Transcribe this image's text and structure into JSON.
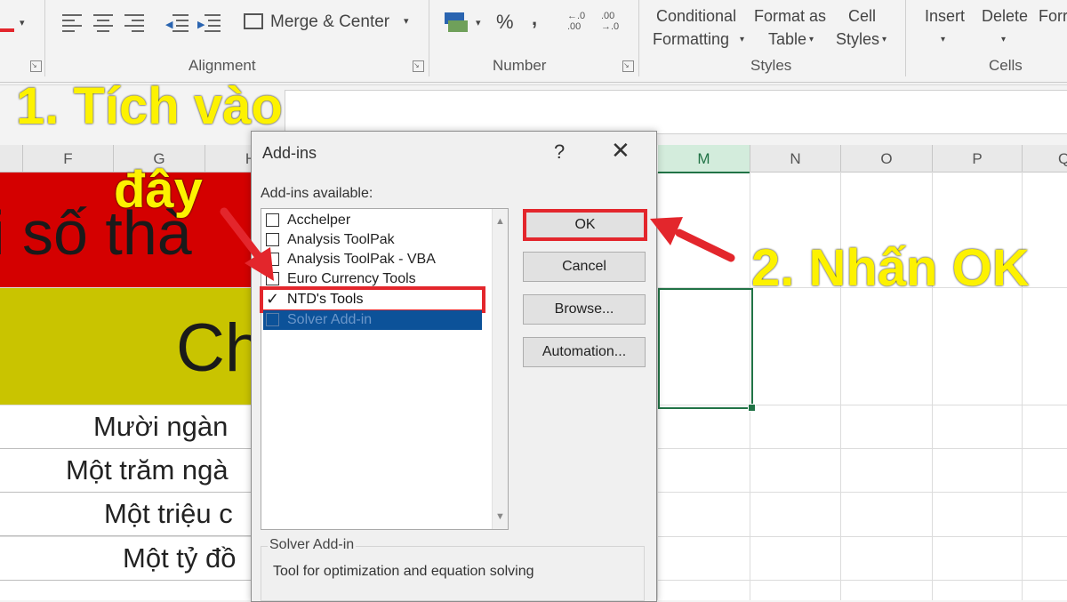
{
  "ribbon": {
    "merge_label": "Merge & Center",
    "alignment_label": "Alignment",
    "percent_symbol": "%",
    "comma_symbol": ",",
    "number_label": "Number",
    "conditional_line1": "Conditional",
    "conditional_line2": "Formatting",
    "format_table_line1": "Format as",
    "format_table_line2": "Table",
    "cell_styles_line1": "Cell",
    "cell_styles_line2": "Styles",
    "styles_label": "Styles",
    "insert_label": "Insert",
    "delete_label": "Delete",
    "format_label": "Forr",
    "cells_label": "Cells"
  },
  "columns": [
    "F",
    "G",
    "H",
    "M",
    "N",
    "O",
    "P",
    "Q"
  ],
  "sheet": {
    "red_row_text": "i số thà",
    "yellow_row_text": "Ch",
    "rows": [
      "Mười ngàn",
      "Một trăm ngà",
      "Một triệu c",
      "Một tỷ đồ"
    ]
  },
  "dialog": {
    "title": "Add-ins",
    "help": "?",
    "close": "✕",
    "available_label": "Add-ins available:",
    "items": [
      {
        "label": "Acchelper",
        "checked": false
      },
      {
        "label": "Analysis ToolPak",
        "checked": false
      },
      {
        "label": "Analysis ToolPak - VBA",
        "checked": false
      },
      {
        "label": "Euro Currency Tools",
        "checked": false
      },
      {
        "label": "NTD's Tools",
        "checked": true
      },
      {
        "label": "Solver Add-in",
        "checked": false
      }
    ],
    "check_glyph": "✓",
    "buttons": {
      "ok": "OK",
      "cancel": "Cancel",
      "browse": "Browse...",
      "automation": "Automation..."
    },
    "description_title": "Solver Add-in",
    "description_text": "Tool for optimization and equation solving"
  },
  "annotations": {
    "step1_line1": "1. Tích vào",
    "step1_line2": "đây",
    "step2": "2. Nhấn OK"
  },
  "colors": {
    "annotation": "#fdf200",
    "arrow": "#e3262c",
    "accent": "#217346",
    "selection": "#0c5299"
  }
}
